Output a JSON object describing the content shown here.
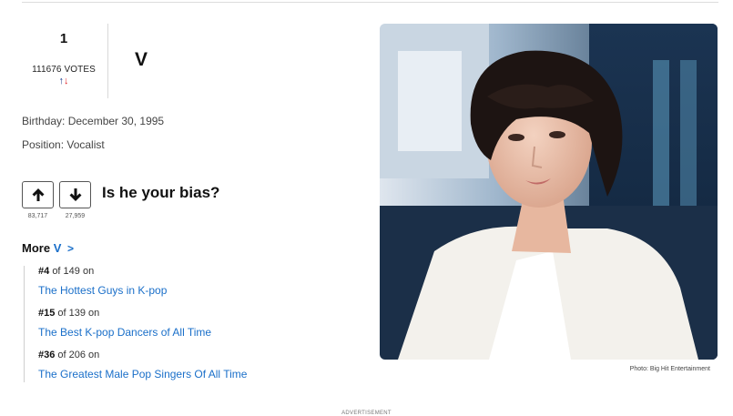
{
  "rank": {
    "number": "1",
    "votes_label": "111676 VOTES",
    "mini_up": "↑",
    "mini_down": "↓"
  },
  "person": {
    "name": "V",
    "birthday": "Birthday: December 30, 1995",
    "position": "Position: Vocalist",
    "photo_credit": "Photo: Big Hit Entertainment"
  },
  "vote": {
    "question": "Is he your bias?",
    "up_count": "83,717",
    "down_count": "27,959",
    "up_icon": "arrow-up-icon",
    "down_icon": "arrow-down-icon"
  },
  "more": {
    "prefix": "More",
    "name": "V",
    "chevron": ">",
    "items": [
      {
        "rank": "#4",
        "of_text": "of 149 on",
        "link": "The Hottest Guys in K-pop"
      },
      {
        "rank": "#15",
        "of_text": "of 139 on",
        "link": "The Best K-pop Dancers of All Time"
      },
      {
        "rank": "#36",
        "of_text": "of 206 on",
        "link": "The Greatest Male Pop Singers Of All Time"
      }
    ]
  },
  "footer": {
    "advertisement": "ADVERTISEMENT"
  },
  "colors": {
    "link": "#1a6fc9",
    "up_arrow": "#1b3c8c",
    "down_arrow": "#e0252b"
  }
}
